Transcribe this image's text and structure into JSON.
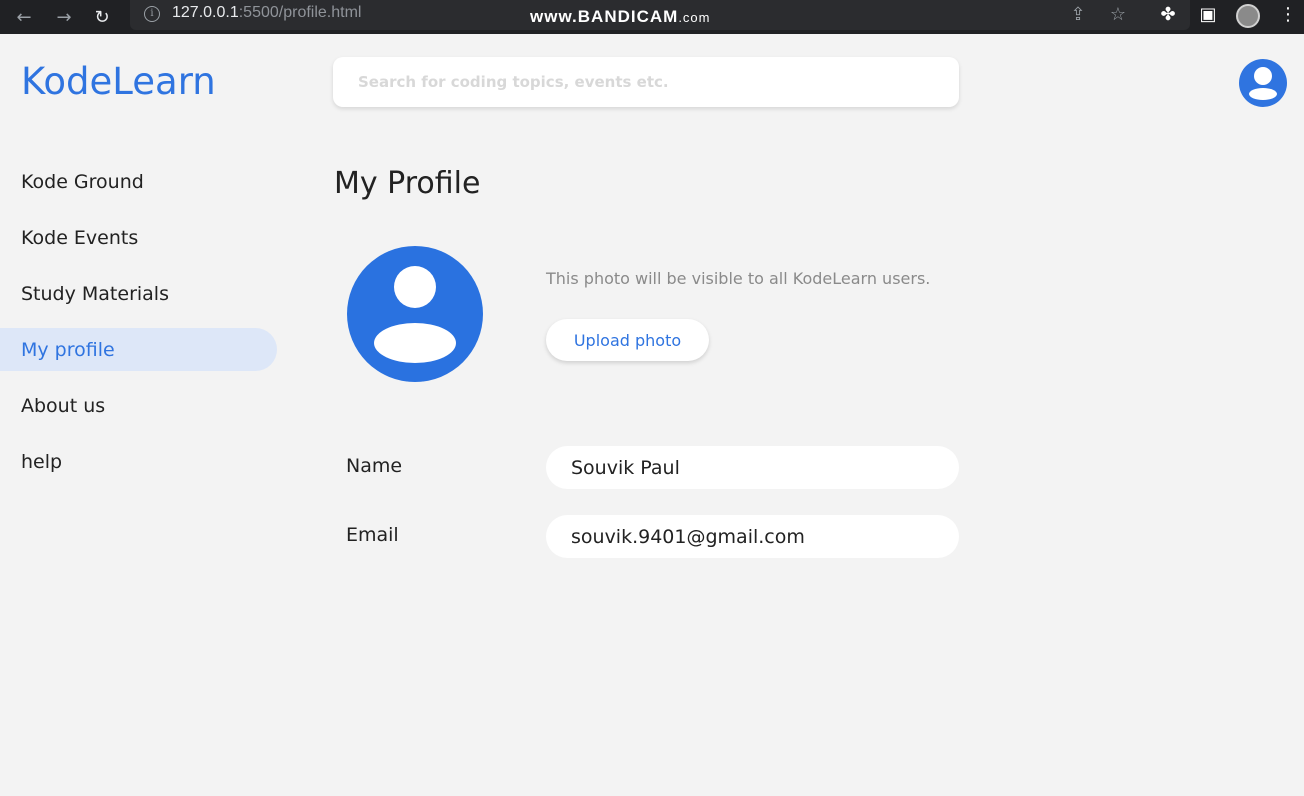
{
  "browser": {
    "url_host": "127.0.0.1",
    "url_path": ":5500/profile.html",
    "watermark_main": "www.BANDICAM",
    "watermark_suffix": ".com"
  },
  "header": {
    "logo": "KodeLearn",
    "search_placeholder": "Search for coding topics, events etc."
  },
  "sidebar": {
    "items": [
      {
        "label": "Kode Ground",
        "active": false
      },
      {
        "label": "Kode Events",
        "active": false
      },
      {
        "label": "Study Materials",
        "active": false
      },
      {
        "label": "My profile",
        "active": true
      },
      {
        "label": "About us",
        "active": false
      },
      {
        "label": "help",
        "active": false
      }
    ]
  },
  "profile": {
    "title": "My Profile",
    "photo_note": "This photo will be visible to all KodeLearn users.",
    "upload_label": "Upload photo",
    "name_label": "Name",
    "name_value": "Souvik Paul",
    "email_label": "Email",
    "email_value": "souvik.9401@gmail.com"
  },
  "colors": {
    "accent": "#2f74e0",
    "active_bg": "#dde7f8"
  }
}
